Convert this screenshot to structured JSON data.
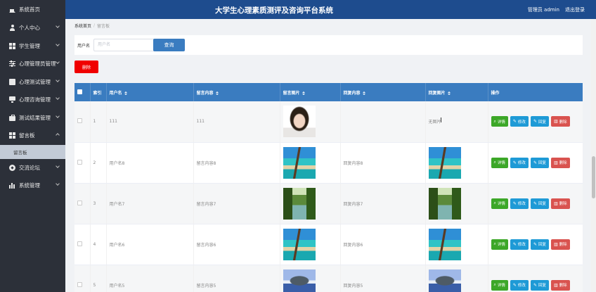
{
  "header": {
    "site_title": "大学生心理素质测评及咨询平台系统",
    "admin_label": "管理员 admin",
    "logout_label": "退出登录"
  },
  "sidebar": {
    "items": [
      {
        "label": "系统首页",
        "icon": "home-icon"
      },
      {
        "label": "个人中心",
        "icon": "user-icon"
      },
      {
        "label": "学生管理",
        "icon": "grid-icon"
      },
      {
        "label": "心理管理员管理",
        "icon": "sliders-icon"
      },
      {
        "label": "心理测试管理",
        "icon": "document-icon"
      },
      {
        "label": "心理咨询管理",
        "icon": "monitor-icon"
      },
      {
        "label": "测试结果管理",
        "icon": "briefcase-icon"
      },
      {
        "label": "留言板",
        "icon": "grid-icon"
      },
      {
        "label": "交流论坛",
        "icon": "compass-icon"
      },
      {
        "label": "系统管理",
        "icon": "bar-chart-icon"
      }
    ],
    "sub_item": "留言板"
  },
  "breadcrumb": {
    "home": "系统首页",
    "separator": "/",
    "current": "留言板"
  },
  "search": {
    "label": "用户名",
    "placeholder": "用户名",
    "value": "",
    "button": "查询"
  },
  "delete_button": "删除",
  "table": {
    "headers": [
      "索引",
      "用户名",
      "留言内容",
      "留言图片",
      "回复内容",
      "回复图片",
      "操作"
    ],
    "rows": [
      {
        "index": "1",
        "username": "111",
        "content": "111",
        "image": "portrait",
        "reply": "",
        "reply_image": "无图片"
      },
      {
        "index": "2",
        "username": "用户名8",
        "content": "留言内容8",
        "image": "dock",
        "reply": "回复内容8",
        "reply_image": "dock"
      },
      {
        "index": "3",
        "username": "用户名7",
        "content": "留言内容7",
        "image": "river",
        "reply": "回复内容7",
        "reply_image": "river"
      },
      {
        "index": "4",
        "username": "用户名6",
        "content": "留言内容6",
        "image": "dock",
        "reply": "回复内容6",
        "reply_image": "dock"
      },
      {
        "index": "5",
        "username": "用户名5",
        "content": "留言内容5",
        "image": "island",
        "reply": "回复内容5",
        "reply_image": "island"
      }
    ],
    "actions": {
      "detail": "详情",
      "edit": "修改",
      "reply": "回复",
      "delete": "删除"
    }
  },
  "colors": {
    "header_bg": "#1e4c8e",
    "sidebar_bg": "#2c3039",
    "table_header_bg": "#3a7cc0",
    "detail_btn": "#3ca728",
    "edit_btn": "#1e9ad6",
    "delete_btn": "#d9534f",
    "batch_delete_btn": "#f00000"
  }
}
